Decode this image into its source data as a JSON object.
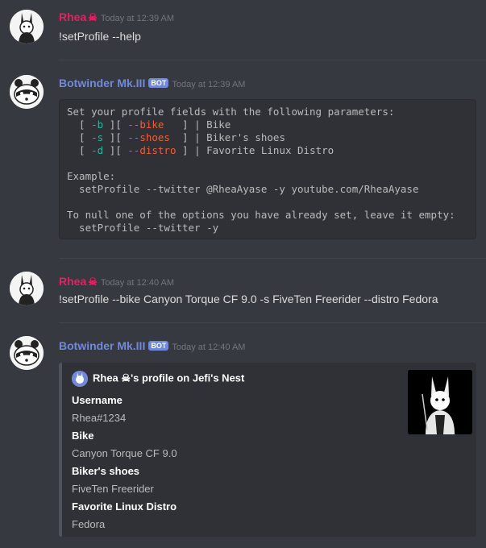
{
  "messages": [
    {
      "author": "Rhea",
      "author_suffix": "☠",
      "timestamp": "Today at 12:39 AM",
      "author_color": "#e91e63",
      "text": "!setProfile --help"
    },
    {
      "author": "Botwinder Mk.III",
      "bot_tag": "BOT",
      "timestamp": "Today at 12:39 AM",
      "author_color": "#7289da",
      "code": {
        "line1": "Set your profile fields with the following parameters:",
        "rows": [
          {
            "short": "-b",
            "long": "--bike  ",
            "desc": "Bike"
          },
          {
            "short": "-s",
            "long": "--shoes ",
            "desc": "Biker's shoes"
          },
          {
            "short": "-d",
            "long": "--distro",
            "desc": "Favorite Linux Distro"
          }
        ],
        "example_label": "Example:",
        "example_cmd": "  setProfile --twitter @RheaAyase -y youtube.com/RheaAyase",
        "null_label": "To null one of the options you have already set, leave it empty:",
        "null_cmd": "  setProfile --twitter -y"
      }
    },
    {
      "author": "Rhea",
      "author_suffix": "☠",
      "timestamp": "Today at 12:40 AM",
      "author_color": "#e91e63",
      "text": "!setProfile --bike Canyon Torque CF 9.0 -s FiveTen Freerider --distro Fedora"
    },
    {
      "author": "Botwinder Mk.III",
      "bot_tag": "BOT",
      "timestamp": "Today at 12:40 AM",
      "author_color": "#7289da",
      "embed": {
        "author_name": "Rhea",
        "author_suffix": "☠",
        "author_rest": "'s profile on Jefi's Nest",
        "fields": [
          {
            "name": "Username",
            "value": "Rhea#1234"
          },
          {
            "name": "Bike",
            "value": "Canyon Torque CF 9.0"
          },
          {
            "name": "Biker's shoes",
            "value": "FiveTen Freerider"
          },
          {
            "name": "Favorite Linux Distro",
            "value": "Fedora"
          }
        ]
      }
    }
  ]
}
